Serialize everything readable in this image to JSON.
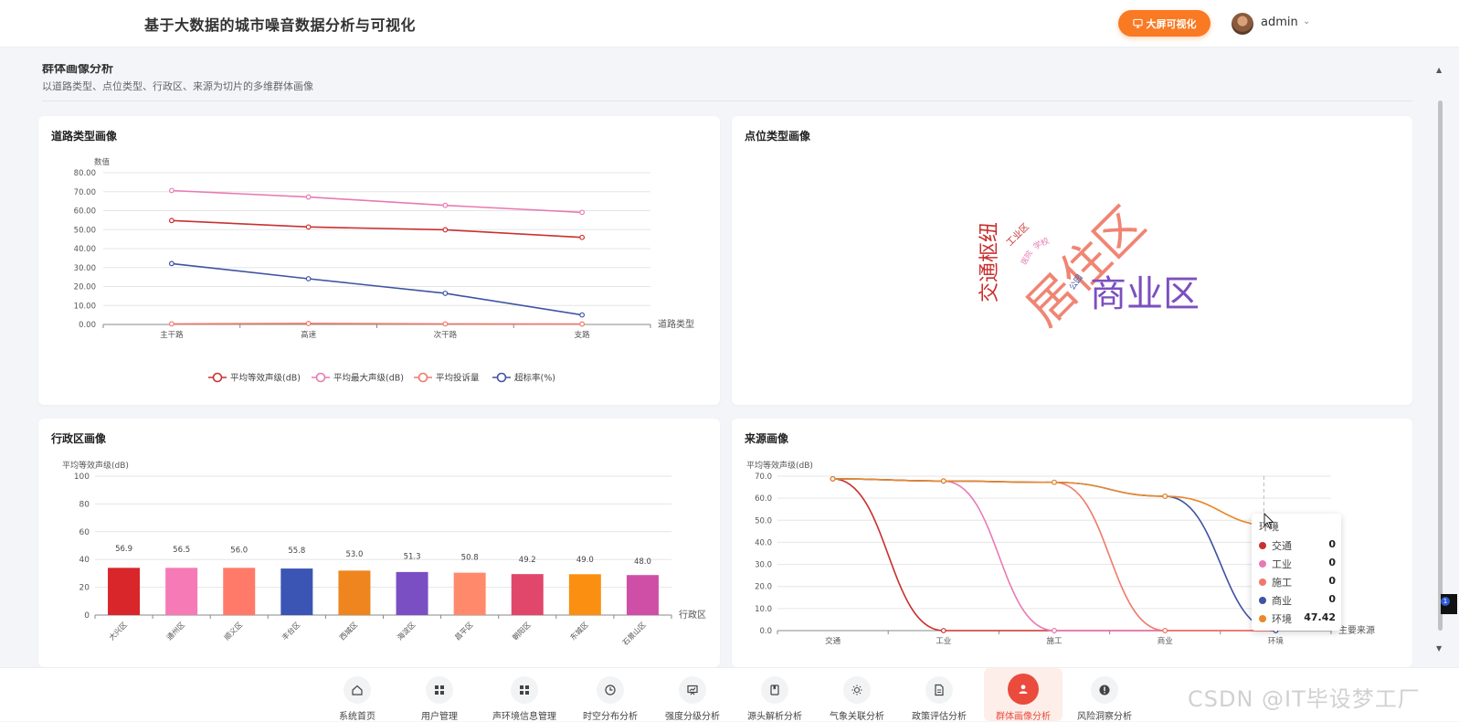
{
  "app": {
    "title": "基于大数据的城市噪音数据分析与可视化"
  },
  "header": {
    "big_screen_label": "大屏可视化",
    "user_name": "admin"
  },
  "section": {
    "title": "群体画像分析",
    "subtitle": "以道路类型、点位类型、行政区、来源为切片的多维群体画像"
  },
  "cards": {
    "road": {
      "title": "道路类型画像"
    },
    "point": {
      "title": "点位类型画像"
    },
    "district": {
      "title": "行政区画像"
    },
    "source": {
      "title": "来源画像"
    }
  },
  "chart_data": [
    {
      "type": "line",
      "title": "道路类型画像",
      "ylabel": "数值",
      "xlabel": "道路类型",
      "ylim": [
        0,
        80
      ],
      "yticks": [
        "0.00",
        "10.00",
        "20.00",
        "30.00",
        "40.00",
        "50.00",
        "60.00",
        "70.00",
        "80.00"
      ],
      "categories": [
        "主干路",
        "高速",
        "次干路",
        "支路"
      ],
      "series": [
        {
          "name": "平均等效声级(dB)",
          "color": "#c8312f",
          "values": [
            54.8,
            51.4,
            49.9,
            45.9
          ]
        },
        {
          "name": "平均最大声级(dB)",
          "color": "#e87ab4",
          "values": [
            70.6,
            67.2,
            62.8,
            59.1
          ]
        },
        {
          "name": "平均投诉量",
          "color": "#f0786a",
          "values": [
            0.3,
            0.5,
            0.3,
            0.2
          ]
        },
        {
          "name": "超标率(%)",
          "color": "#3e53a3",
          "values": [
            32.1,
            24.1,
            16.4,
            5.0
          ]
        }
      ],
      "legend": "bottom"
    },
    {
      "type": "wordcloud",
      "title": "点位类型画像",
      "words": [
        {
          "text": "居住区",
          "color": "#f08573",
          "weight": 1.0
        },
        {
          "text": "商业区",
          "color": "#7c4fbf",
          "weight": 0.8
        },
        {
          "text": "交通枢纽",
          "color": "#c8312f",
          "weight": 0.5
        },
        {
          "text": "工业区",
          "color": "#c8312f",
          "weight": 0.2
        },
        {
          "text": "学校",
          "color": "#e87ab4",
          "weight": 0.18
        },
        {
          "text": "医院",
          "color": "#e87ab4",
          "weight": 0.15
        },
        {
          "text": "公园",
          "color": "#3e53a3",
          "weight": 0.15
        }
      ]
    },
    {
      "type": "bar",
      "title": "行政区画像",
      "ylabel": "平均等效声级(dB)",
      "xlabel": "行政区",
      "ylim": [
        0,
        100
      ],
      "yticks": [
        "0",
        "20",
        "40",
        "60",
        "80",
        "100"
      ],
      "categories": [
        "大兴区",
        "通州区",
        "顺义区",
        "丰台区",
        "西城区",
        "海淀区",
        "昌平区",
        "朝阳区",
        "东城区",
        "石景山区"
      ],
      "values": [
        56.9,
        56.5,
        56.0,
        55.8,
        53.0,
        51.3,
        50.8,
        49.2,
        49.0,
        48.0
      ],
      "labels": [
        "56.9",
        "56.5",
        "56.0",
        "55.8",
        "53.0",
        "51.3",
        "50.8",
        "49.2",
        "49.0",
        "48.0"
      ],
      "bar_values": [
        34,
        34,
        34,
        33.5,
        32,
        31,
        30.5,
        29.5,
        29.4,
        28.8
      ],
      "colors": [
        "#d9262a",
        "#f57ab5",
        "#ff7a68",
        "#3b55b5",
        "#ee851e",
        "#7b4fc4",
        "#ff8a6b",
        "#e0476a",
        "#fb8f12",
        "#cf4fa6"
      ]
    },
    {
      "type": "line",
      "title": "来源画像",
      "ylabel": "平均等效声级(dB)",
      "xlabel": "主要来源",
      "ylim": [
        0,
        70
      ],
      "yticks": [
        "0.0",
        "10.0",
        "20.0",
        "30.0",
        "40.0",
        "50.0",
        "60.0",
        "70.0"
      ],
      "categories": [
        "交通",
        "工业",
        "施工",
        "商业",
        "环境"
      ],
      "series": [
        {
          "name": "交通",
          "color": "#c8312f",
          "values": [
            68.8,
            0,
            0,
            0,
            0
          ]
        },
        {
          "name": "工业",
          "color": "#e87ab4",
          "values": [
            68.8,
            67.8,
            0,
            0,
            0
          ]
        },
        {
          "name": "施工",
          "color": "#f0786a",
          "values": [
            68.8,
            67.8,
            67.2,
            0,
            0
          ]
        },
        {
          "name": "商业",
          "color": "#3e53a3",
          "values": [
            68.8,
            67.8,
            67.2,
            60.9,
            0
          ]
        },
        {
          "name": "环境",
          "color": "#e8892b",
          "values": [
            68.8,
            67.8,
            67.2,
            60.9,
            47.42
          ]
        }
      ]
    }
  ],
  "tooltip": {
    "title": "环境",
    "rows": [
      {
        "name": "交通",
        "value": "0",
        "color": "#c8312f"
      },
      {
        "name": "工业",
        "value": "0",
        "color": "#e87ab4"
      },
      {
        "name": "施工",
        "value": "0",
        "color": "#f0786a"
      },
      {
        "name": "商业",
        "value": "0",
        "color": "#3e53a3"
      },
      {
        "name": "环境",
        "value": "47.42",
        "color": "#e8892b"
      }
    ]
  },
  "nav": {
    "items": [
      {
        "label": "系统首页",
        "icon": "home-icon"
      },
      {
        "label": "用户管理",
        "icon": "grid-icon"
      },
      {
        "label": "声环境信息管理",
        "icon": "grid-icon"
      },
      {
        "label": "时空分布分析",
        "icon": "clock-icon"
      },
      {
        "label": "强度分级分析",
        "icon": "presentation-icon"
      },
      {
        "label": "源头解析分析",
        "icon": "book-icon"
      },
      {
        "label": "气象关联分析",
        "icon": "sun-icon"
      },
      {
        "label": "政策评估分析",
        "icon": "document-icon"
      },
      {
        "label": "群体画像分析",
        "icon": "user-icon",
        "active": true
      },
      {
        "label": "风险洞察分析",
        "icon": "alert-icon"
      }
    ]
  },
  "watermark": "CSDN @IT毕设梦工厂",
  "badge": "1"
}
